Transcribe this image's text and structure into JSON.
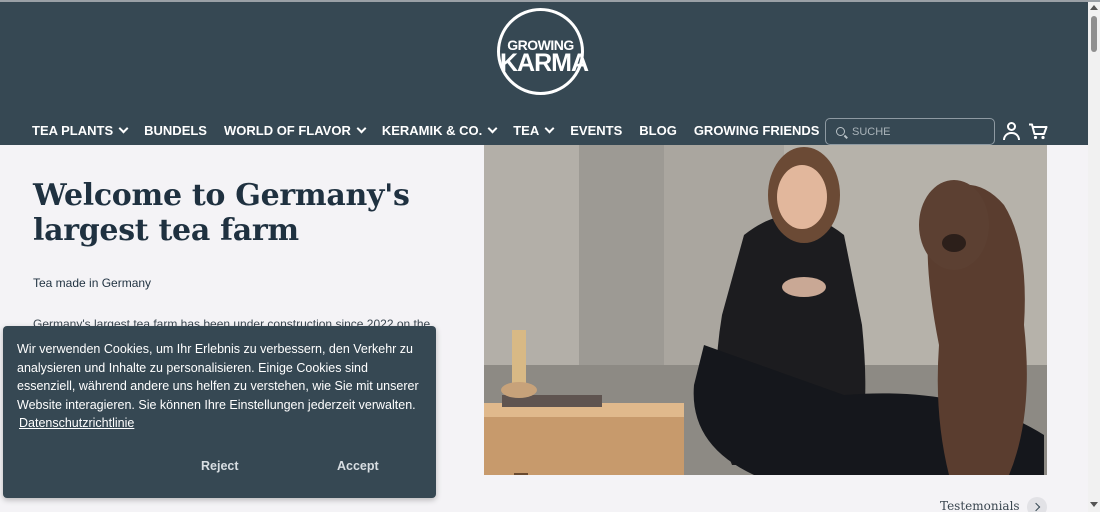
{
  "brand": {
    "line1": "GROWING",
    "line2": "KARMA"
  },
  "nav": {
    "items": [
      {
        "label": "TEA PLANTS",
        "dropdown": true
      },
      {
        "label": "BUNDELS",
        "dropdown": false
      },
      {
        "label": "WORLD OF FLAVOR",
        "dropdown": true
      },
      {
        "label": "KERAMIK & CO.",
        "dropdown": true
      },
      {
        "label": "TEA",
        "dropdown": true
      },
      {
        "label": "EVENTS",
        "dropdown": false
      },
      {
        "label": "BLOG",
        "dropdown": false
      },
      {
        "label": "GROWING FRIENDS",
        "dropdown": false
      }
    ]
  },
  "search": {
    "placeholder": "SUCHE",
    "value": ""
  },
  "icons": {
    "search": "search-icon",
    "account": "account-icon",
    "cart": "cart-icon"
  },
  "hero": {
    "title": "Welcome to Germany's largest tea farm",
    "subtitle": "Tea made in Germany",
    "body": "Germany's largest tea farm has been under construction since 2022 on the"
  },
  "testimonials": {
    "label": "Testemonials"
  },
  "cookie": {
    "text": "Wir verwenden Cookies, um Ihr Erlebnis zu verbessern, den Verkehr zu analysieren und Inhalte zu personalisieren. Einige Cookies sind essenziell, während andere uns helfen zu verstehen, wie Sie mit unserer Website interagieren. Sie können Ihre Einstellungen jederzeit verwalten.",
    "link": "Datenschutzrichtlinie",
    "reject": "Reject",
    "accept": "Accept"
  },
  "colors": {
    "header_bg": "#364853",
    "content_bg": "#f4f3f6",
    "text_dark": "#1f3140",
    "cookie_bg": "#364853"
  }
}
